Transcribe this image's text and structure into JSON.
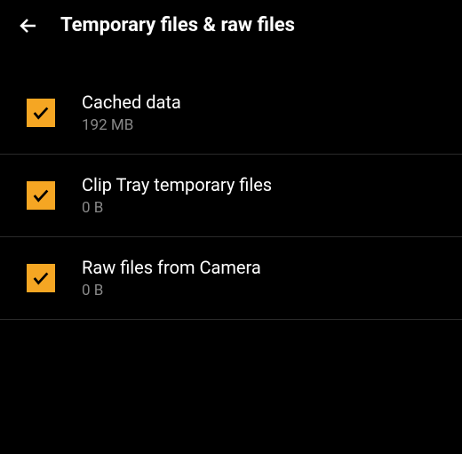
{
  "header": {
    "title": "Temporary files & raw files"
  },
  "items": [
    {
      "label": "Cached data",
      "size": "192 MB",
      "checked": true
    },
    {
      "label": "Clip Tray temporary files",
      "size": "0 B",
      "checked": true
    },
    {
      "label": "Raw files from Camera",
      "size": "0 B",
      "checked": true
    }
  ],
  "colors": {
    "accent": "#f5a623",
    "background": "#000000",
    "text": "#ffffff",
    "subtext": "#888888"
  }
}
